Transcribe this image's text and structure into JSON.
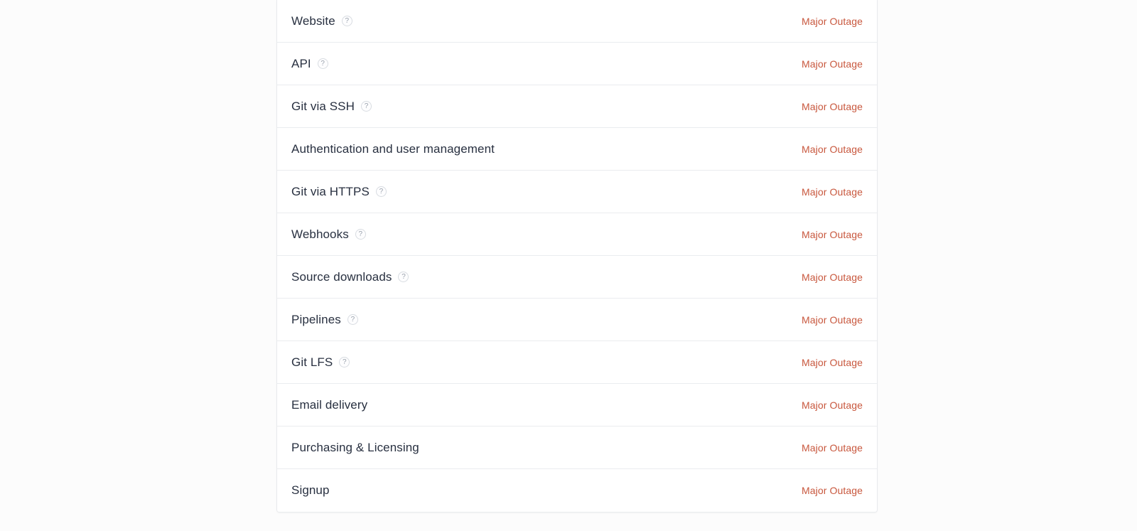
{
  "page": {
    "background_color": "#fcfcfc",
    "card_background_color": "#ffffff",
    "card_border_color": "#e9ebee",
    "divider_color": "#eaecef",
    "component_name_color": "#283040",
    "status_color": "#c8573d",
    "help_icon_glyph": "?"
  },
  "components_list": {
    "rows": [
      {
        "name": "Website",
        "status": "Major Outage",
        "has_help_icon": true
      },
      {
        "name": "API",
        "status": "Major Outage",
        "has_help_icon": true
      },
      {
        "name": "Git via SSH",
        "status": "Major Outage",
        "has_help_icon": true
      },
      {
        "name": "Authentication and user management",
        "status": "Major Outage",
        "has_help_icon": false
      },
      {
        "name": "Git via HTTPS",
        "status": "Major Outage",
        "has_help_icon": true
      },
      {
        "name": "Webhooks",
        "status": "Major Outage",
        "has_help_icon": true
      },
      {
        "name": "Source downloads",
        "status": "Major Outage",
        "has_help_icon": true
      },
      {
        "name": "Pipelines",
        "status": "Major Outage",
        "has_help_icon": true
      },
      {
        "name": "Git LFS",
        "status": "Major Outage",
        "has_help_icon": true
      },
      {
        "name": "Email delivery",
        "status": "Major Outage",
        "has_help_icon": false
      },
      {
        "name": "Purchasing & Licensing",
        "status": "Major Outage",
        "has_help_icon": false
      },
      {
        "name": "Signup",
        "status": "Major Outage",
        "has_help_icon": false
      }
    ]
  }
}
